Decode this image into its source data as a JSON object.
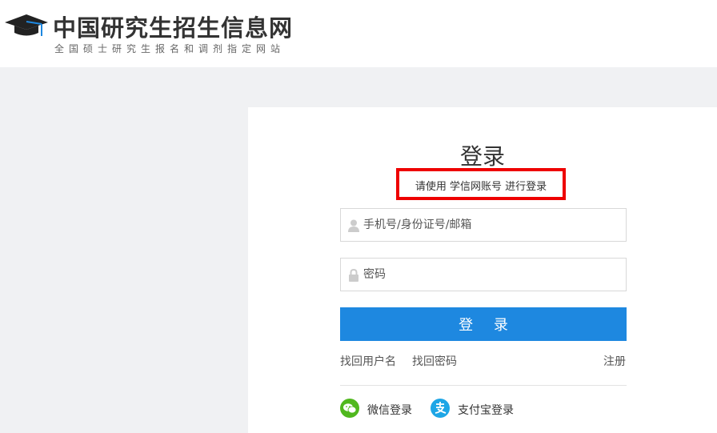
{
  "header": {
    "site_title": "中国研究生招生信息网",
    "site_subtitle": "全国硕士研究生报名和调剂指定网站",
    "logo_icon": "graduation-cap-icon"
  },
  "login": {
    "title": "登录",
    "hint": "请使用 学信网账号 进行登录",
    "hint_highlight_color": "#ee0000",
    "username_placeholder": "手机号/身份证号/邮箱",
    "password_placeholder": "密码",
    "submit_label": "登 录",
    "submit_color": "#1e88e0",
    "links": {
      "find_username": "找回用户名",
      "find_password": "找回密码",
      "register": "注册"
    },
    "social": {
      "wechat_label": "微信登录",
      "wechat_color": "#50b81e",
      "alipay_label": "支付宝登录",
      "alipay_color": "#1ea6e6"
    }
  }
}
